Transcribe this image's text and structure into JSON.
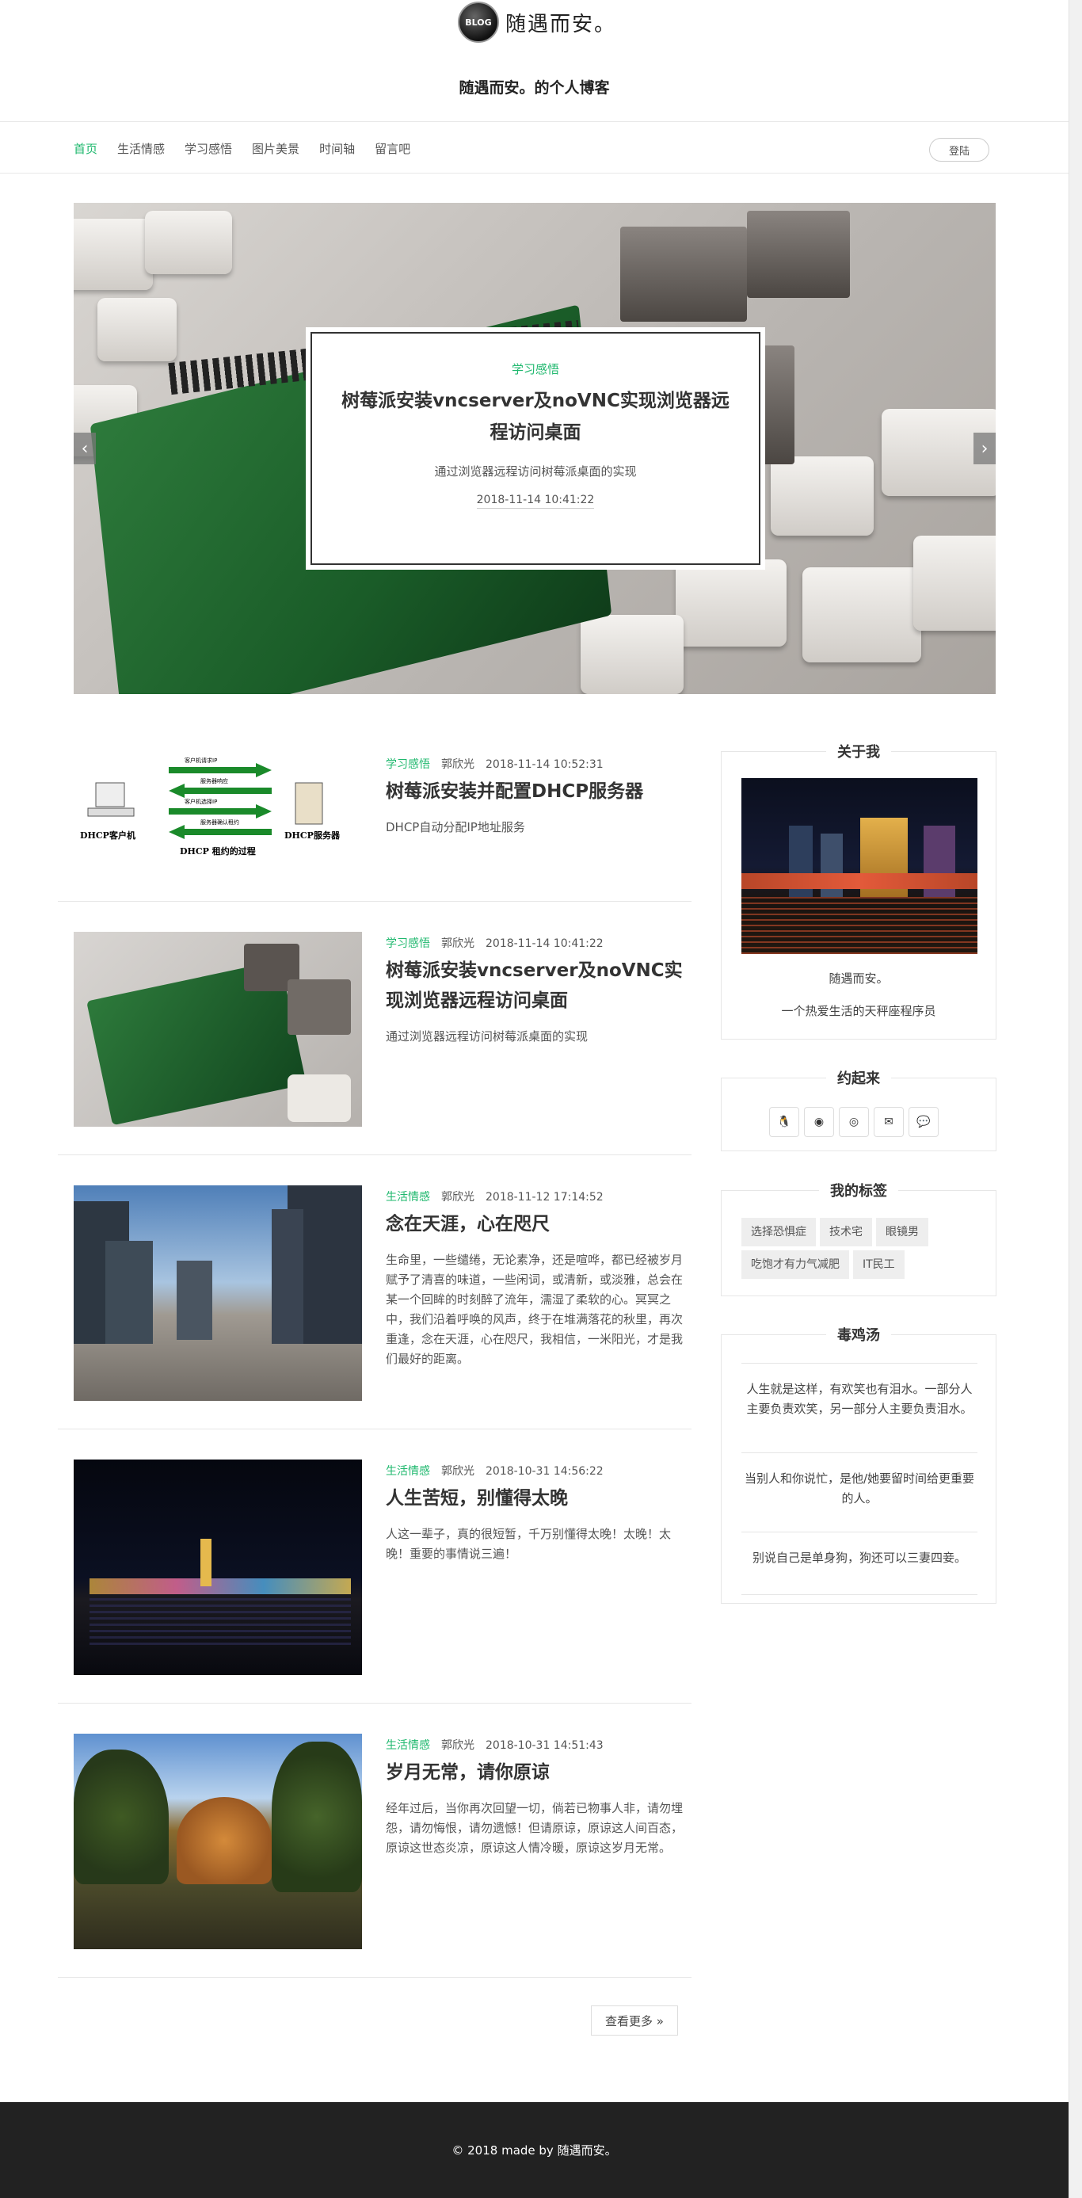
{
  "logo": {
    "badge": "BLOG",
    "text": "随遇而安。"
  },
  "site_title": "随遇而安。的个人博客",
  "nav": {
    "items": [
      "首页",
      "生活情感",
      "学习感悟",
      "图片美景",
      "时间轴",
      "留言吧"
    ],
    "active_index": 0,
    "login_label": "登陆"
  },
  "carousel": {
    "category": "学习感悟",
    "title": "树莓派安装vncserver及noVNC实现浏览器远程访问桌面",
    "description": "通过浏览器远程访问树莓派桌面的实现",
    "date": "2018-11-14 10:41:22",
    "prev_icon": "‹",
    "next_icon": "›"
  },
  "posts": [
    {
      "category": "学习感悟",
      "author": "郭欣光",
      "date": "2018-11-14 10:52:31",
      "title": "树莓派安装并配置DHCP服务器",
      "description": "DHCP自动分配IP地址服务",
      "thumb": "dhcp-diagram"
    },
    {
      "category": "学习感悟",
      "author": "郭欣光",
      "date": "2018-11-14 10:41:22",
      "title": "树莓派安装vncserver及noVNC实现浏览器远程访问桌面",
      "description": "通过浏览器远程访问树莓派桌面的实现",
      "thumb": "raspberry-pi"
    },
    {
      "category": "生活情感",
      "author": "郭欣光",
      "date": "2018-11-12 17:14:52",
      "title": "念在天涯，心在咫尺",
      "description": "生命里，一些缱绻，无论素净，还是喧哗，都已经被岁月赋予了清喜的味道，一些闲词，或清新，或淡雅，总会在某一个回眸的时刻醉了流年，濡湿了柔软的心。冥冥之中，我们沿着呼唤的风声，终于在堆满落花的秋里，再次重逢，念在天涯，心在咫尺，我相信，一米阳光，才是我们最好的距离。",
      "thumb": "city-plaza"
    },
    {
      "category": "生活情感",
      "author": "郭欣光",
      "date": "2018-10-31 14:56:22",
      "title": "人生苦短，别懂得太晚",
      "description": "人这一辈子，真的很短暂，千万别懂得太晚！太晚！太晚！重要的事情说三遍！",
      "thumb": "night-lake"
    },
    {
      "category": "生活情感",
      "author": "郭欣光",
      "date": "2018-10-31 14:51:43",
      "title": "岁月无常，请你原谅",
      "description": "经年过后，当你再次回望一切，倘若已物事人非，请勿埋怨，请勿悔恨，请勿遗憾！但请原谅，原谅这人间百态，原谅这世态炎凉，原谅这人情冷暖，原谅这岁月无常。",
      "thumb": "autumn-park"
    }
  ],
  "dhcp": {
    "client": "DHCP客户机",
    "server": "DHCP服务器",
    "caption": "DHCP 租约的过程",
    "steps": [
      "客户机请求IP",
      "服务器响应",
      "客户机选择IP",
      "服务器确认租约"
    ]
  },
  "more_label": "查看更多 »",
  "sidebar": {
    "about": {
      "title": "关于我",
      "name": "随遇而安。",
      "desc": "一个热爱生活的天秤座程序员"
    },
    "contact": {
      "title": "约起来",
      "icons": [
        "qq-icon",
        "github-icon",
        "weibo-icon",
        "email-icon",
        "wechat-icon"
      ],
      "glyphs": [
        "🐧",
        "◉",
        "◎",
        "✉",
        "💬"
      ]
    },
    "tags": {
      "title": "我的标签",
      "items": [
        "选择恐惧症",
        "技术宅",
        "眼镜男",
        "吃饱才有力气减肥",
        "IT民工"
      ]
    },
    "quotes": {
      "title": "毒鸡汤",
      "items": [
        "人生就是这样，有欢笑也有泪水。一部分人主要负责欢笑，另一部分人主要负责泪水。",
        "当别人和你说忙，是他/她要留时间给更重要的人。",
        "别说自己是单身狗，狗还可以三妻四妾。"
      ]
    }
  },
  "footer": {
    "prefix": "© 2018 made by ",
    "name": "随遇而安。"
  },
  "colors": {
    "accent": "#1fb86e",
    "footer_bg": "#222222",
    "text": "#333333"
  }
}
